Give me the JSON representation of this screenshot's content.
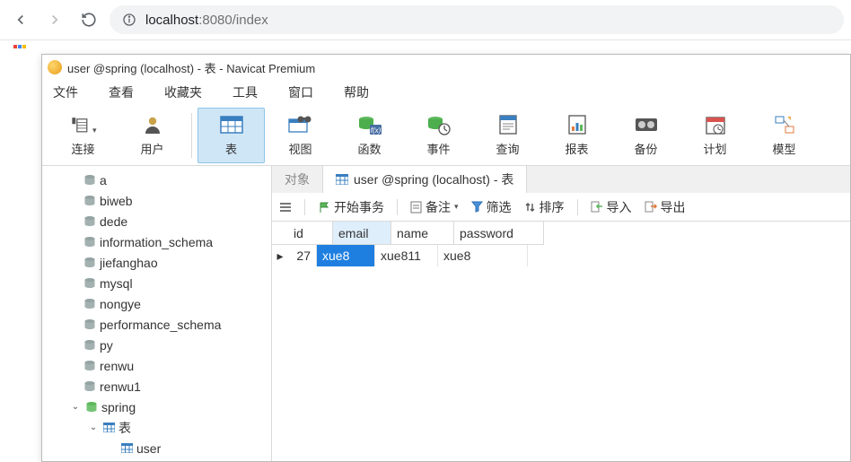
{
  "browser": {
    "url_host": "localhost",
    "url_port_path": ":8080/index"
  },
  "window": {
    "title": "user @spring (localhost) - 表 - Navicat Premium"
  },
  "menu": [
    "文件",
    "查看",
    "收藏夹",
    "工具",
    "窗口",
    "帮助"
  ],
  "toolbar": [
    {
      "label": "连接"
    },
    {
      "label": "用户"
    },
    {
      "label": "表",
      "active": true
    },
    {
      "label": "视图"
    },
    {
      "label": "函数"
    },
    {
      "label": "事件"
    },
    {
      "label": "查询"
    },
    {
      "label": "报表"
    },
    {
      "label": "备份"
    },
    {
      "label": "计划"
    },
    {
      "label": "模型"
    }
  ],
  "tree": {
    "dbs": [
      "a",
      "biweb",
      "dede",
      "information_schema",
      "jiefanghao",
      "mysql",
      "nongye",
      "performance_schema",
      "py",
      "renwu",
      "renwu1"
    ],
    "open_db": "spring",
    "open_group": "表",
    "open_table": "user"
  },
  "tabs": {
    "inactive": "对象",
    "active": "user @spring (localhost) - 表"
  },
  "actions": {
    "start_tx": "开始事务",
    "memo": "备注",
    "filter": "筛选",
    "sort": "排序",
    "import": "导入",
    "export": "导出"
  },
  "grid": {
    "columns": [
      "id",
      "email",
      "name",
      "password"
    ],
    "selected_col": "email",
    "rows": [
      {
        "id": "27",
        "email": "xue8",
        "name": "xue811",
        "password": "xue8"
      }
    ]
  }
}
